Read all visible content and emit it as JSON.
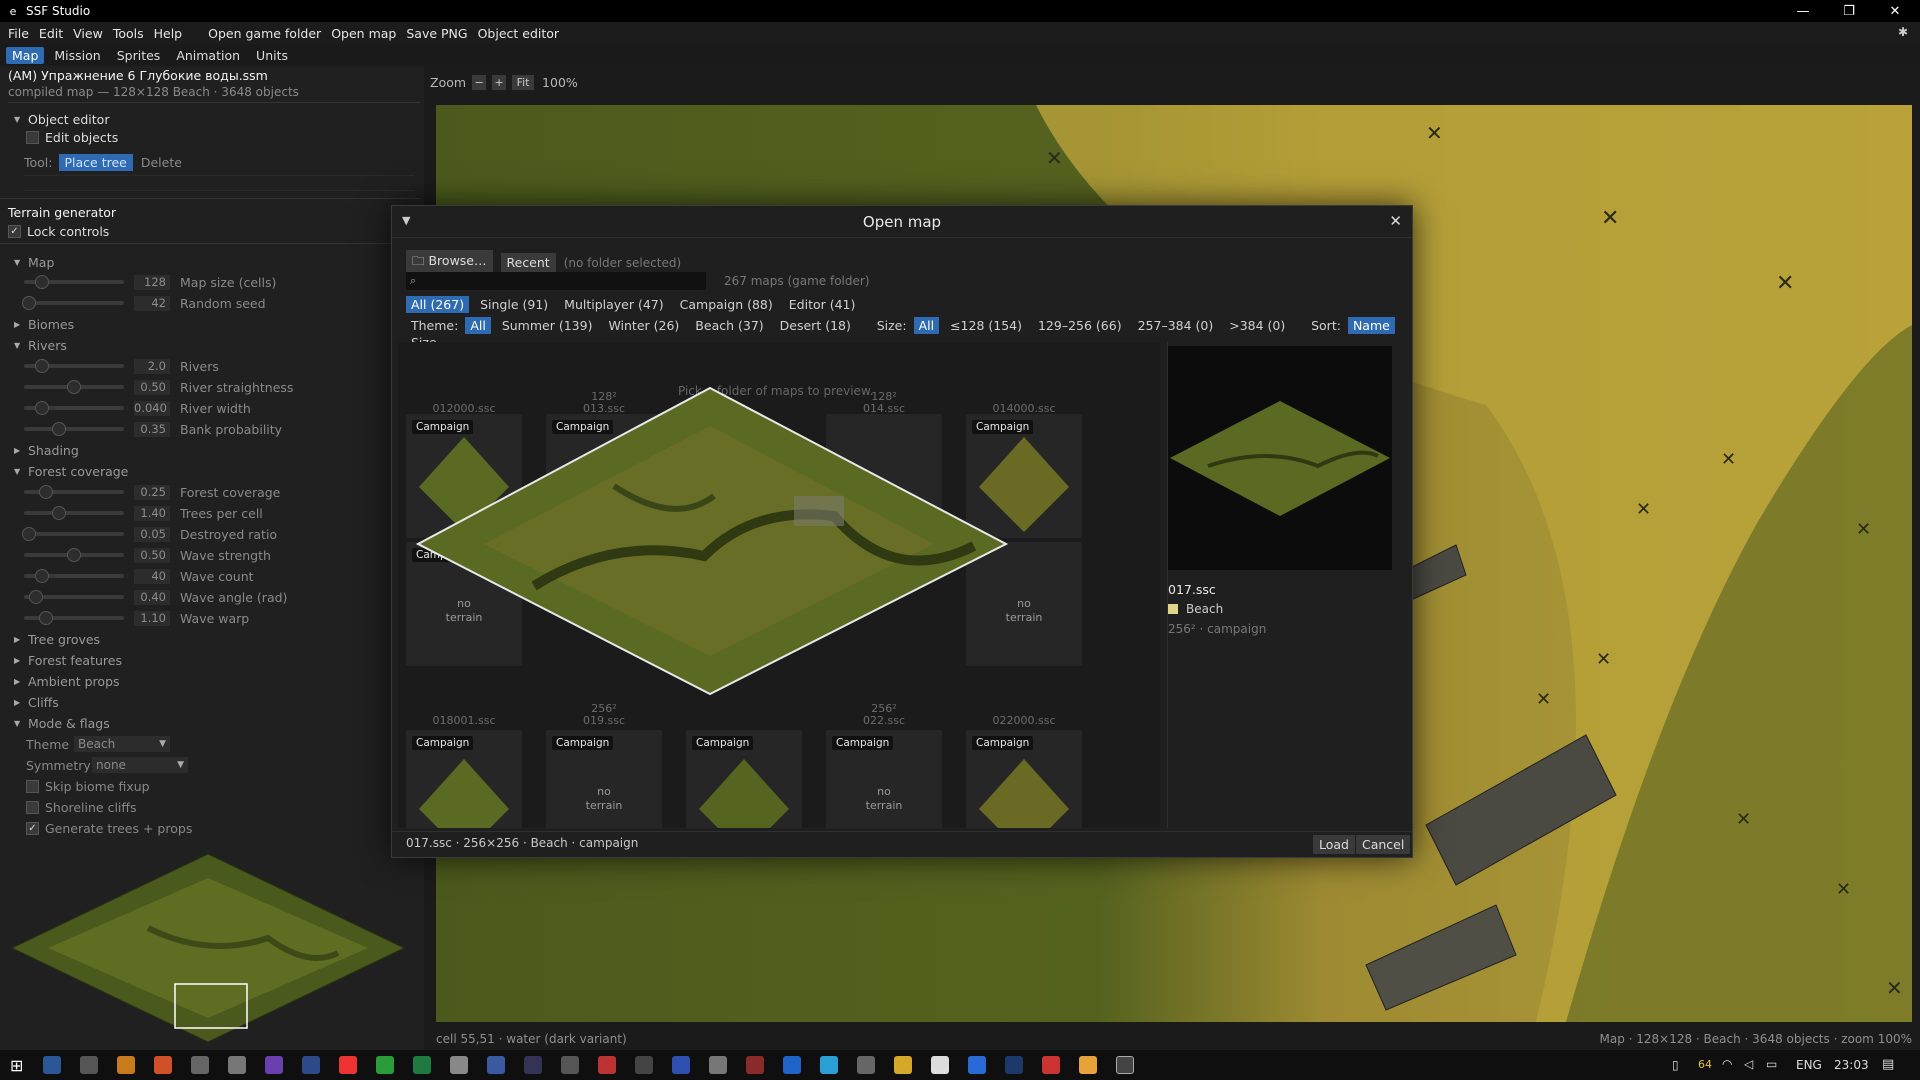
{
  "window": {
    "title": "SSF Studio",
    "icon": "e",
    "controls": [
      "—",
      "❐",
      "✕"
    ]
  },
  "menu": [
    "File",
    "Edit",
    "View",
    "Tools",
    "Help",
    "Open game folder",
    "Open map",
    "Save PNG",
    "Object editor"
  ],
  "tabs": [
    {
      "label": "Map",
      "active": true
    },
    {
      "label": "Mission"
    },
    {
      "label": "Sprites"
    },
    {
      "label": "Animation"
    },
    {
      "label": "Units"
    }
  ],
  "left": {
    "file_title": "(AM) Упражнение 6 Глубокие воды.ssm",
    "file_sub": "compiled map — 128×128 Beach · 3648 objects",
    "object_editor": "Object editor",
    "edit_objects": "Edit objects",
    "tool_label": "Tool:",
    "tool_place": "Place tree",
    "tool_delete": "Delete",
    "terrain_generator": "Terrain generator",
    "lock_controls": "Lock controls",
    "map": "Map",
    "map_sliders": [
      {
        "value": "128",
        "label": "Map size (cells)",
        "frac": 0.18
      },
      {
        "value": "42",
        "label": "Random seed",
        "frac": 0.05
      }
    ],
    "biomes": "Biomes",
    "rivers": "Rivers",
    "river_sliders": [
      {
        "value": "2.0",
        "label": "Rivers",
        "frac": 0.18
      },
      {
        "value": "0.50",
        "label": "River straightness",
        "frac": 0.5
      },
      {
        "value": "0.040",
        "label": "River width",
        "frac": 0.18
      },
      {
        "value": "0.35",
        "label": "Bank probability",
        "frac": 0.35
      }
    ],
    "shading": "Shading",
    "forest_coverage": "Forest coverage",
    "forest_sliders": [
      {
        "value": "0.25",
        "label": "Forest coverage",
        "frac": 0.22
      },
      {
        "value": "1.40",
        "label": "Trees per cell",
        "frac": 0.35
      },
      {
        "value": "0.05",
        "label": "Destroyed ratio",
        "frac": 0.05
      },
      {
        "value": "0.50",
        "label": "Wave strength",
        "frac": 0.5
      },
      {
        "value": "40",
        "label": "Wave count",
        "frac": 0.18
      },
      {
        "value": "0.40",
        "label": "Wave angle (rad)",
        "frac": 0.12
      },
      {
        "value": "1.10",
        "label": "Wave warp",
        "frac": 0.22
      }
    ],
    "tree_groves": "Tree groves",
    "forest_features": "Forest features",
    "ambient_props": "Ambient props",
    "cliffs": "Cliffs",
    "mode_flags": "Mode & flags",
    "theme_label": "Theme",
    "theme_value": "Beach",
    "symmetry_label": "Symmetry",
    "symmetry_value": "none",
    "skip_biome": "Skip biome fixup",
    "shoreline": "Shoreline cliffs",
    "generate": "Generate trees + props"
  },
  "zoom": {
    "label": "Zoom",
    "minus": "−",
    "plus": "+",
    "fit": "Fit",
    "value": "100%"
  },
  "status": {
    "left": "cell 55,51 · water (dark variant)",
    "right": "Map · 128×128 · Beach · 3648 objects · zoom 100%"
  },
  "modal": {
    "title": "Open map",
    "browse": "Browse…",
    "recent": "Recent",
    "folder": "(no folder selected)",
    "count": "267 maps (game folder)",
    "filters": [
      "All (267)",
      "Single (91)",
      "Multiplayer (47)",
      "Campaign (88)",
      "Editor (41)"
    ],
    "theme_label": "Theme:",
    "themes": [
      "All",
      "Summer (139)",
      "Winter (26)",
      "Beach (37)",
      "Desert (18)"
    ],
    "size_label": "Size:",
    "sizes": [
      "All",
      "≤128 (154)",
      "129–256 (66)",
      "257–384 (0)",
      ">384 (0)"
    ],
    "sort_label": "Sort:",
    "sorts": [
      "Name",
      "Size"
    ],
    "hint": "Pick a folder of maps to preview.",
    "cards_row0_names": [
      "012000.ssc",
      "013.ssc",
      "",
      "014.ssc",
      "014000.ssc"
    ],
    "cards_row0_sizes": [
      "",
      "128²",
      "",
      "128²",
      ""
    ],
    "cards_row1_names": [
      "018001.ssc",
      "019.ssc",
      "",
      "022.ssc",
      "022000.ssc"
    ],
    "cards_row1_sizes": [
      "",
      "256²",
      "",
      "256²",
      ""
    ],
    "badge": "Campaign",
    "no_terrain": "no\nterrain",
    "preview_name": "017.ssc",
    "preview_theme": "Beach",
    "preview_meta": "256² · campaign",
    "footer": "017.ssc · 256×256 · Beach · campaign",
    "load": "Load",
    "cancel": "Cancel"
  },
  "taskbar": {
    "lang": "ENG",
    "time": "23:03",
    "temp": "64"
  },
  "colors": {
    "accent": "#2f6bb3",
    "sand": "#b9a23a",
    "grass": "#4e5d1c"
  }
}
